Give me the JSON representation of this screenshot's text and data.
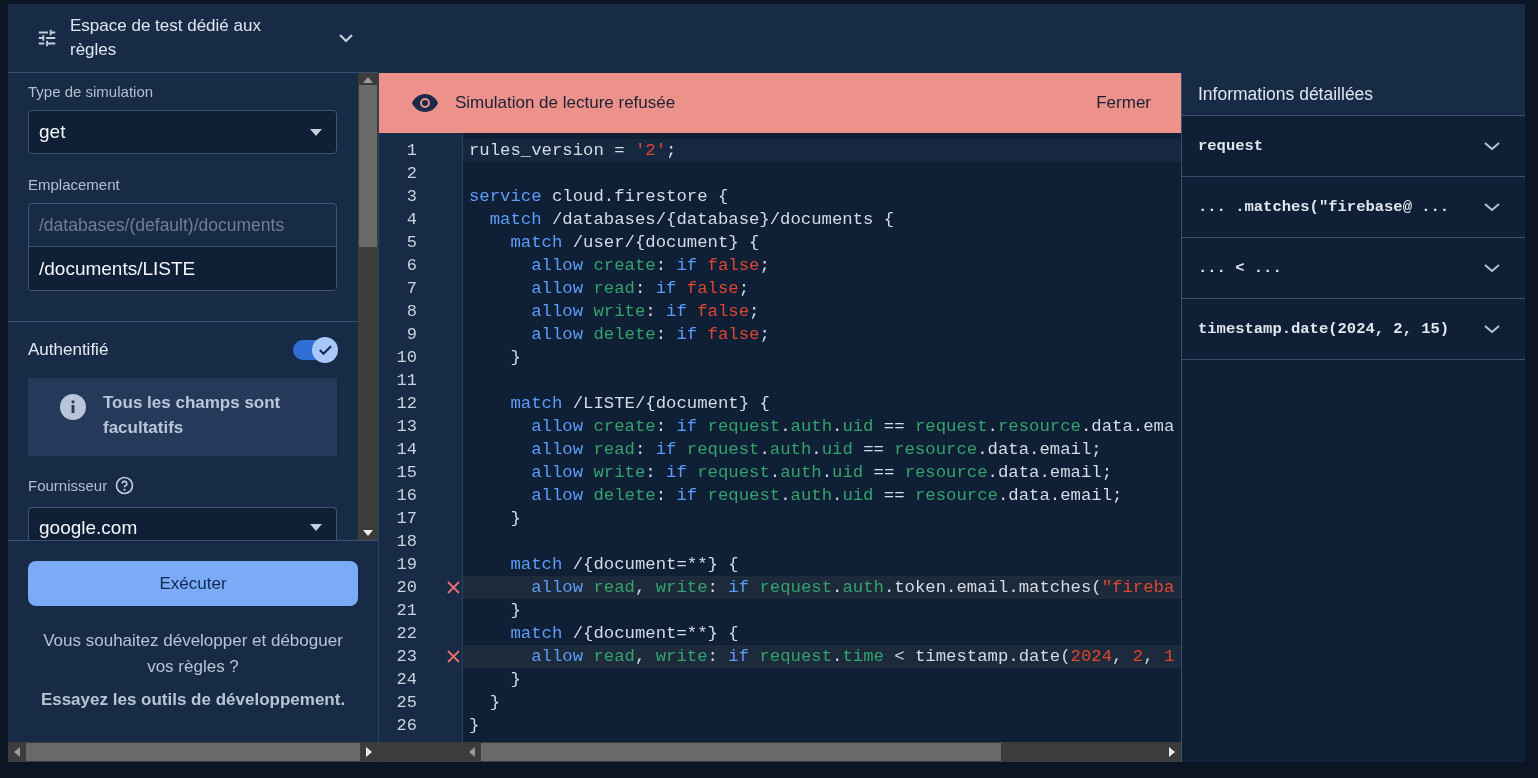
{
  "sidebar": {
    "title": "Espace de test dédié aux règles",
    "simulation_type": {
      "label": "Type de simulation",
      "value": "get"
    },
    "location": {
      "label": "Emplacement",
      "prefix": "/databases/(default)/documents",
      "value": "/documents/LISTE"
    },
    "authenticated": {
      "label": "Authentifié",
      "on": true
    },
    "info": "Tous les champs sont facultatifs",
    "provider": {
      "label": "Fournisseur",
      "value": "google.com"
    },
    "run_button": "Exécuter",
    "promo_text": "Vous souhaitez développer et déboguer vos règles ?",
    "promo_link": "Essayez les outils de développement."
  },
  "banner": {
    "message": "Simulation de lecture refusée",
    "close": "Fermer"
  },
  "editor": {
    "lines": [
      {
        "number": "1",
        "kind": "current",
        "tokens": [
          {
            "kind": "plain",
            "text": "rules_version = "
          },
          {
            "kind": "literal",
            "text": "'2'"
          },
          {
            "kind": "plain",
            "text": ";"
          }
        ]
      },
      {
        "number": "2",
        "kind": "plain"
      },
      {
        "number": "3",
        "kind": "plain",
        "tokens": [
          {
            "kind": "keyword",
            "text": "service"
          },
          {
            "kind": "plain",
            "text": " cloud.firestore {"
          }
        ]
      },
      {
        "number": "4",
        "kind": "plain",
        "tokens": [
          {
            "kind": "keyword",
            "text": "  match"
          },
          {
            "kind": "plain",
            "text": " /databases/{database}/documents {"
          }
        ]
      },
      {
        "number": "5",
        "kind": "plain",
        "tokens": [
          {
            "kind": "keyword",
            "text": "    match"
          },
          {
            "kind": "plain",
            "text": " /user/{document} {"
          }
        ]
      },
      {
        "number": "6",
        "kind": "plain",
        "tokens": [
          {
            "kind": "keyword",
            "text": "      allow"
          },
          {
            "kind": "name",
            "text": " create"
          },
          {
            "kind": "plain",
            "text": ": "
          },
          {
            "kind": "keyword",
            "text": "if"
          },
          {
            "kind": "literal",
            "text": " false"
          },
          {
            "kind": "plain",
            "text": ";"
          }
        ]
      },
      {
        "number": "7",
        "kind": "plain",
        "tokens": [
          {
            "kind": "keyword",
            "text": "      allow"
          },
          {
            "kind": "name",
            "text": " read"
          },
          {
            "kind": "plain",
            "text": ": "
          },
          {
            "kind": "keyword",
            "text": "if"
          },
          {
            "kind": "literal",
            "text": " false"
          },
          {
            "kind": "plain",
            "text": ";"
          }
        ]
      },
      {
        "number": "8",
        "kind": "plain",
        "tokens": [
          {
            "kind": "keyword",
            "text": "      allow"
          },
          {
            "kind": "name",
            "text": " write"
          },
          {
            "kind": "plain",
            "text": ": "
          },
          {
            "kind": "keyword",
            "text": "if"
          },
          {
            "kind": "literal",
            "text": " false"
          },
          {
            "kind": "plain",
            "text": ";"
          }
        ]
      },
      {
        "number": "9",
        "kind": "plain",
        "tokens": [
          {
            "kind": "keyword",
            "text": "      allow"
          },
          {
            "kind": "name",
            "text": " delete"
          },
          {
            "kind": "plain",
            "text": ": "
          },
          {
            "kind": "keyword",
            "text": "if"
          },
          {
            "kind": "literal",
            "text": " false"
          },
          {
            "kind": "plain",
            "text": ";"
          }
        ]
      },
      {
        "number": "10",
        "kind": "plain",
        "tokens": [
          {
            "kind": "plain",
            "text": "    }"
          }
        ]
      },
      {
        "number": "11",
        "kind": "plain"
      },
      {
        "number": "12",
        "kind": "plain",
        "tokens": [
          {
            "kind": "keyword",
            "text": "    match"
          },
          {
            "kind": "plain",
            "text": " /LISTE/{document} {"
          }
        ]
      },
      {
        "number": "13",
        "kind": "plain",
        "tokens": [
          {
            "kind": "keyword",
            "text": "      allow"
          },
          {
            "kind": "name",
            "text": " create"
          },
          {
            "kind": "plain",
            "text": ": "
          },
          {
            "kind": "keyword",
            "text": "if"
          },
          {
            "kind": "name",
            "text": " request"
          },
          {
            "kind": "plain",
            "text": "."
          },
          {
            "kind": "name",
            "text": "auth"
          },
          {
            "kind": "plain",
            "text": "."
          },
          {
            "kind": "name",
            "text": "uid"
          },
          {
            "kind": "plain",
            "text": " == "
          },
          {
            "kind": "name",
            "text": "request"
          },
          {
            "kind": "plain",
            "text": "."
          },
          {
            "kind": "name",
            "text": "resource"
          },
          {
            "kind": "plain",
            "text": ".data.ema"
          }
        ]
      },
      {
        "number": "14",
        "kind": "plain",
        "tokens": [
          {
            "kind": "keyword",
            "text": "      allow"
          },
          {
            "kind": "name",
            "text": " read"
          },
          {
            "kind": "plain",
            "text": ": "
          },
          {
            "kind": "keyword",
            "text": "if"
          },
          {
            "kind": "name",
            "text": " request"
          },
          {
            "kind": "plain",
            "text": "."
          },
          {
            "kind": "name",
            "text": "auth"
          },
          {
            "kind": "plain",
            "text": "."
          },
          {
            "kind": "name",
            "text": "uid"
          },
          {
            "kind": "plain",
            "text": " == "
          },
          {
            "kind": "name",
            "text": "resource"
          },
          {
            "kind": "plain",
            "text": ".data.email;"
          }
        ]
      },
      {
        "number": "15",
        "kind": "plain",
        "tokens": [
          {
            "kind": "keyword",
            "text": "      allow"
          },
          {
            "kind": "name",
            "text": " write"
          },
          {
            "kind": "plain",
            "text": ": "
          },
          {
            "kind": "keyword",
            "text": "if"
          },
          {
            "kind": "name",
            "text": " request"
          },
          {
            "kind": "plain",
            "text": "."
          },
          {
            "kind": "name",
            "text": "auth"
          },
          {
            "kind": "plain",
            "text": "."
          },
          {
            "kind": "name",
            "text": "uid"
          },
          {
            "kind": "plain",
            "text": " == "
          },
          {
            "kind": "name",
            "text": "resource"
          },
          {
            "kind": "plain",
            "text": ".data.email;"
          }
        ]
      },
      {
        "number": "16",
        "kind": "plain",
        "tokens": [
          {
            "kind": "keyword",
            "text": "      allow"
          },
          {
            "kind": "name",
            "text": " delete"
          },
          {
            "kind": "plain",
            "text": ": "
          },
          {
            "kind": "keyword",
            "text": "if"
          },
          {
            "kind": "name",
            "text": " request"
          },
          {
            "kind": "plain",
            "text": "."
          },
          {
            "kind": "name",
            "text": "auth"
          },
          {
            "kind": "plain",
            "text": "."
          },
          {
            "kind": "name",
            "text": "uid"
          },
          {
            "kind": "plain",
            "text": " == "
          },
          {
            "kind": "name",
            "text": "resource"
          },
          {
            "kind": "plain",
            "text": ".data.email;"
          }
        ]
      },
      {
        "number": "17",
        "kind": "plain",
        "tokens": [
          {
            "kind": "plain",
            "text": "    }"
          }
        ]
      },
      {
        "number": "18",
        "kind": "plain"
      },
      {
        "number": "19",
        "kind": "plain",
        "tokens": [
          {
            "kind": "keyword",
            "text": "    match"
          },
          {
            "kind": "plain",
            "text": " /{document=**} {"
          }
        ]
      },
      {
        "number": "20",
        "kind": "error",
        "tokens": [
          {
            "kind": "keyword",
            "text": "      allow"
          },
          {
            "kind": "name",
            "text": " read"
          },
          {
            "kind": "plain",
            "text": ", "
          },
          {
            "kind": "name",
            "text": "write"
          },
          {
            "kind": "plain",
            "text": ": "
          },
          {
            "kind": "keyword",
            "text": "if"
          },
          {
            "kind": "name",
            "text": " request"
          },
          {
            "kind": "plain",
            "text": "."
          },
          {
            "kind": "name",
            "text": "auth"
          },
          {
            "kind": "plain",
            "text": ".token.email.matches("
          },
          {
            "kind": "literal",
            "text": "\"fireba"
          }
        ]
      },
      {
        "number": "21",
        "kind": "plain",
        "tokens": [
          {
            "kind": "plain",
            "text": "    }"
          }
        ]
      },
      {
        "number": "22",
        "kind": "plain",
        "tokens": [
          {
            "kind": "keyword",
            "text": "    match"
          },
          {
            "kind": "plain",
            "text": " /{document=**} {"
          }
        ]
      },
      {
        "number": "23",
        "kind": "error",
        "tokens": [
          {
            "kind": "keyword",
            "text": "      allow"
          },
          {
            "kind": "name",
            "text": " read"
          },
          {
            "kind": "plain",
            "text": ", "
          },
          {
            "kind": "name",
            "text": "write"
          },
          {
            "kind": "plain",
            "text": ": "
          },
          {
            "kind": "keyword",
            "text": "if"
          },
          {
            "kind": "name",
            "text": " request"
          },
          {
            "kind": "plain",
            "text": "."
          },
          {
            "kind": "name",
            "text": "time"
          },
          {
            "kind": "plain",
            "text": " < timestamp.date("
          },
          {
            "kind": "literal",
            "text": "2024"
          },
          {
            "kind": "plain",
            "text": ", "
          },
          {
            "kind": "literal",
            "text": "2"
          },
          {
            "kind": "plain",
            "text": ", "
          },
          {
            "kind": "literal",
            "text": "1"
          }
        ]
      },
      {
        "number": "24",
        "kind": "plain",
        "tokens": [
          {
            "kind": "plain",
            "text": "    }"
          }
        ]
      },
      {
        "number": "25",
        "kind": "plain",
        "tokens": [
          {
            "kind": "plain",
            "text": "  }"
          }
        ]
      },
      {
        "number": "26",
        "kind": "plain",
        "tokens": [
          {
            "kind": "plain",
            "text": "}"
          }
        ]
      }
    ]
  },
  "details": {
    "title": "Informations détaillées",
    "items": [
      {
        "text": "request",
        "expanded": false
      },
      {
        "text": "... .matches(\"firebase@ ...",
        "expanded": false
      },
      {
        "text": "... < ...",
        "expanded": false
      },
      {
        "text": "timestamp.date(2024, 2, 15)",
        "expanded": false
      }
    ]
  }
}
